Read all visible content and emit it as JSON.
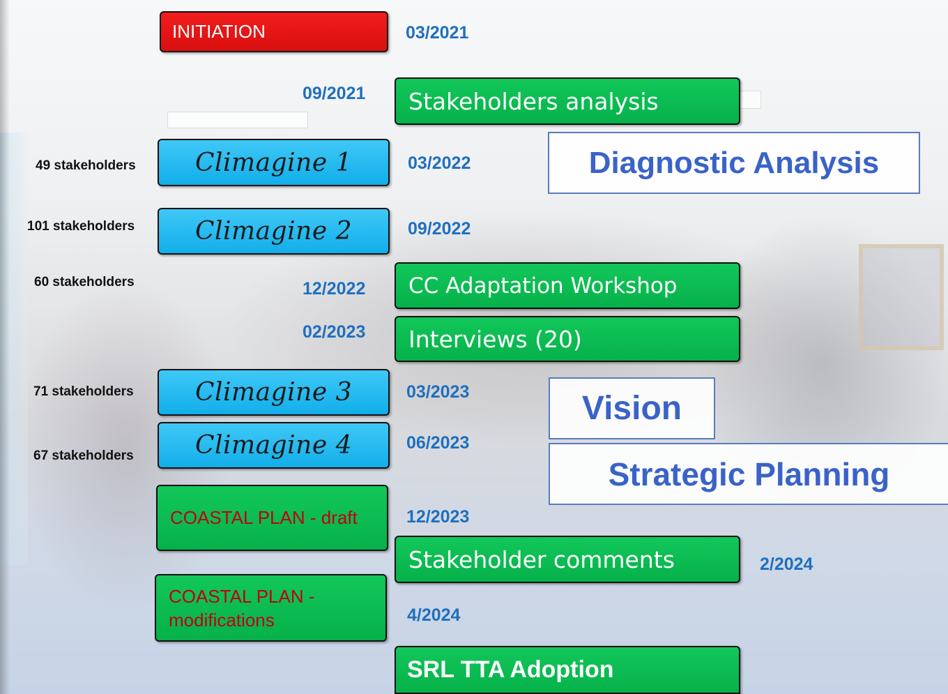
{
  "steps": {
    "initiation": "INITIATION",
    "stakeholders_analysis": "Stakeholders analysis",
    "climagine_1": "Climagine 1",
    "climagine_2": "Climagine 2",
    "cc_workshop": "CC Adaptation Workshop",
    "interviews": "Interviews (20)",
    "climagine_3": "Climagine 3",
    "climagine_4": "Climagine 4",
    "coastal_draft": "COASTAL PLAN - draft",
    "stakeholder_comments": "Stakeholder comments",
    "coastal_mod_line1": "COASTAL PLAN -",
    "coastal_mod_line2": "modifications",
    "adoption": "SRL TTA Adoption"
  },
  "dates": {
    "initiation": "03/2021",
    "stakeholders_analysis": "09/2021",
    "climagine_1": "03/2022",
    "climagine_2": "09/2022",
    "cc_workshop": "12/2022",
    "interviews": "02/2023",
    "climagine_3": "03/2023",
    "climagine_4": "06/2023",
    "coastal_draft": "12/2023",
    "stakeholder_comments": "2/2024",
    "coastal_mod": "4/2024"
  },
  "counts": {
    "climagine_1": "49 stakeholders",
    "climagine_2": "101 stakeholders",
    "cc_workshop": "60 stakeholders",
    "climagine_3": "71 stakeholders",
    "climagine_4": "67 stakeholders"
  },
  "phases": {
    "diagnostic": "Diagnostic Analysis",
    "vision": "Vision",
    "strategic": "Strategic Planning"
  },
  "colors": {
    "red_box": "#e31515",
    "green_box": "#0bbd51",
    "blue_box": "#2bbdf2",
    "date_text": "#1f6fbf",
    "phase_text": "#3a63c8"
  }
}
